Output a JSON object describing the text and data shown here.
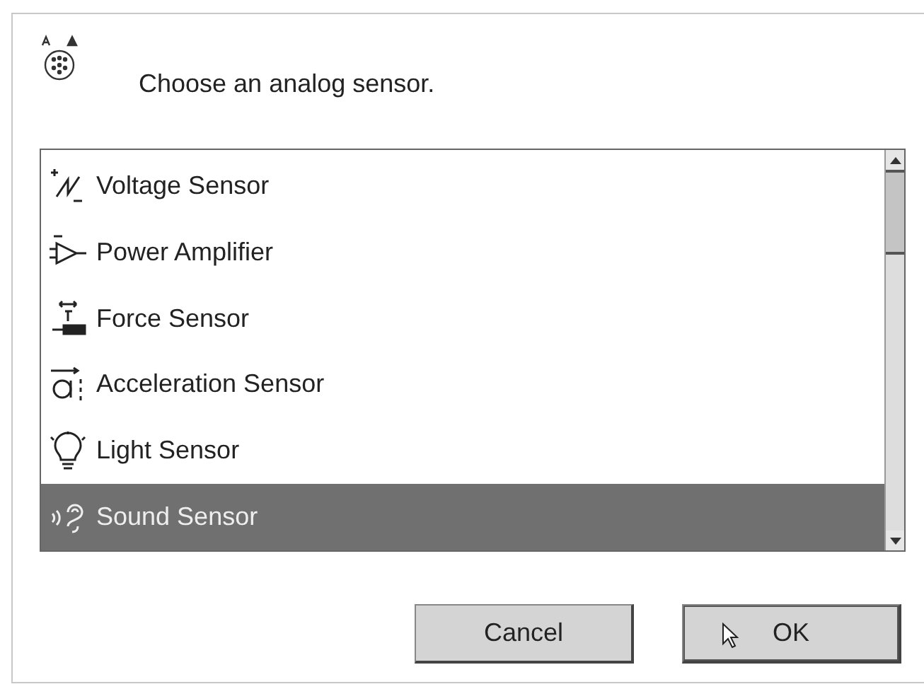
{
  "dialog": {
    "prompt": "Choose an analog sensor.",
    "sensors": [
      {
        "kind": "voltage",
        "label": "Voltage Sensor",
        "selected": false
      },
      {
        "kind": "amplifier",
        "label": "Power Amplifier",
        "selected": false
      },
      {
        "kind": "force",
        "label": "Force Sensor",
        "selected": false
      },
      {
        "kind": "acceleration",
        "label": "Acceleration Sensor",
        "selected": false
      },
      {
        "kind": "light",
        "label": "Light Sensor",
        "selected": false
      },
      {
        "kind": "sound",
        "label": "Sound Sensor",
        "selected": true
      }
    ],
    "buttons": [
      {
        "label": "Cancel",
        "default": false
      },
      {
        "label": "OK",
        "default": true
      }
    ]
  }
}
